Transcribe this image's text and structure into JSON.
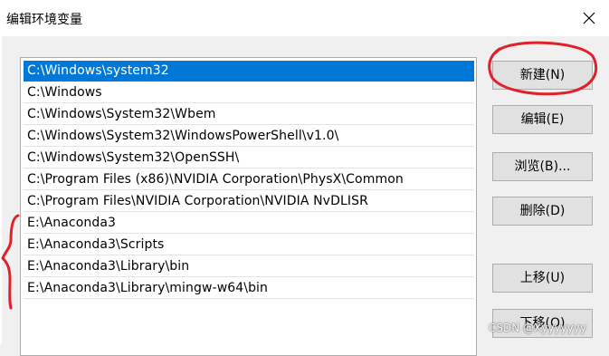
{
  "dialog": {
    "title": "编辑环境变量",
    "close_icon": "close-icon"
  },
  "list": {
    "items": [
      "C:\\Windows\\system32",
      "C:\\Windows",
      "C:\\Windows\\System32\\Wbem",
      "C:\\Windows\\System32\\WindowsPowerShell\\v1.0\\",
      "C:\\Windows\\System32\\OpenSSH\\",
      "C:\\Program Files (x86)\\NVIDIA Corporation\\PhysX\\Common",
      "C:\\Program Files\\NVIDIA Corporation\\NVIDIA NvDLISR",
      "E:\\Anaconda3",
      "E:\\Anaconda3\\Scripts",
      "E:\\Anaconda3\\Library\\bin",
      "E:\\Anaconda3\\Library\\mingw-w64\\bin"
    ],
    "selected_index": 0
  },
  "buttons": {
    "new": "新建(N)",
    "edit": "编辑(E)",
    "browse": "浏览(B)...",
    "delete": "删除(D)",
    "move_up": "上移(U)",
    "move_down": "下移(O)"
  },
  "watermark": "CSDN @Xyyyyyyy",
  "colors": {
    "selection": "#0078d7",
    "annotation": "#e0202a"
  }
}
